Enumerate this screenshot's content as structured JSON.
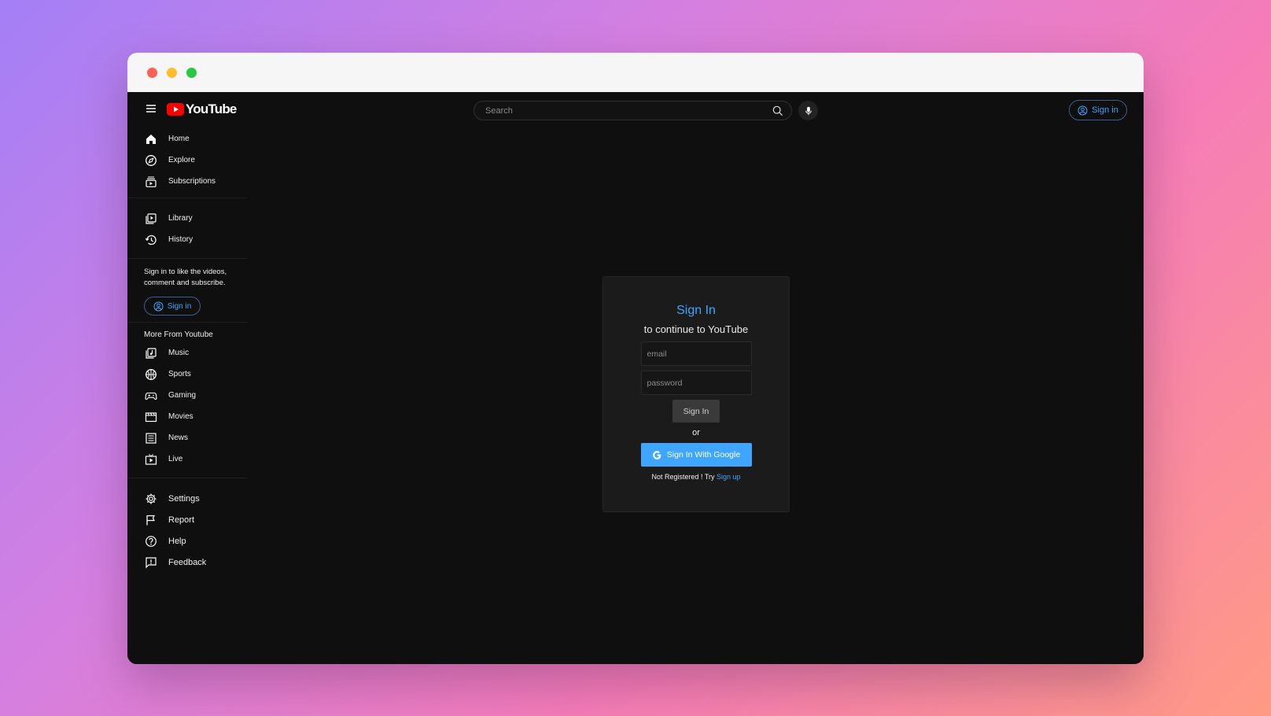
{
  "window": {
    "controls": [
      "close",
      "minimize",
      "maximize"
    ]
  },
  "topbar": {
    "logo_text": "YouTube",
    "search_placeholder": "Search",
    "sign_in_label": "Sign in"
  },
  "sidebar": {
    "main_items": [
      {
        "label": "Home",
        "icon": "home-icon"
      },
      {
        "label": "Explore",
        "icon": "compass-icon"
      },
      {
        "label": "Subscriptions",
        "icon": "subscriptions-icon"
      }
    ],
    "library_items": [
      {
        "label": "Library",
        "icon": "library-icon"
      },
      {
        "label": "History",
        "icon": "history-icon"
      }
    ],
    "promo_text": "Sign in to like the videos, comment and subscribe.",
    "promo_button": "Sign in",
    "more_title": "More From Youtube",
    "more_items": [
      {
        "label": "Music",
        "icon": "music-icon"
      },
      {
        "label": "Sports",
        "icon": "sports-icon"
      },
      {
        "label": "Gaming",
        "icon": "gaming-icon"
      },
      {
        "label": "Movies",
        "icon": "movies-icon"
      },
      {
        "label": "News",
        "icon": "news-icon"
      },
      {
        "label": "Live",
        "icon": "live-icon"
      }
    ],
    "settings_items": [
      {
        "label": "Settings",
        "icon": "gear-icon"
      },
      {
        "label": "Report",
        "icon": "flag-icon"
      },
      {
        "label": "Help",
        "icon": "help-icon"
      },
      {
        "label": "Feedback",
        "icon": "feedback-icon"
      }
    ]
  },
  "signin_card": {
    "title": "Sign In",
    "subtitle": "to continue to YouTube",
    "email_placeholder": "email",
    "password_placeholder": "password",
    "submit_label": "Sign In",
    "or_text": "or",
    "google_label": "Sign In With Google",
    "register_text": "Not Registered ! Try",
    "register_link": "Sign up"
  },
  "colors": {
    "accent": "#3ea6ff",
    "background": "#0f0f0f",
    "card": "#1b1b1b",
    "youtube_red": "#ff0000"
  }
}
